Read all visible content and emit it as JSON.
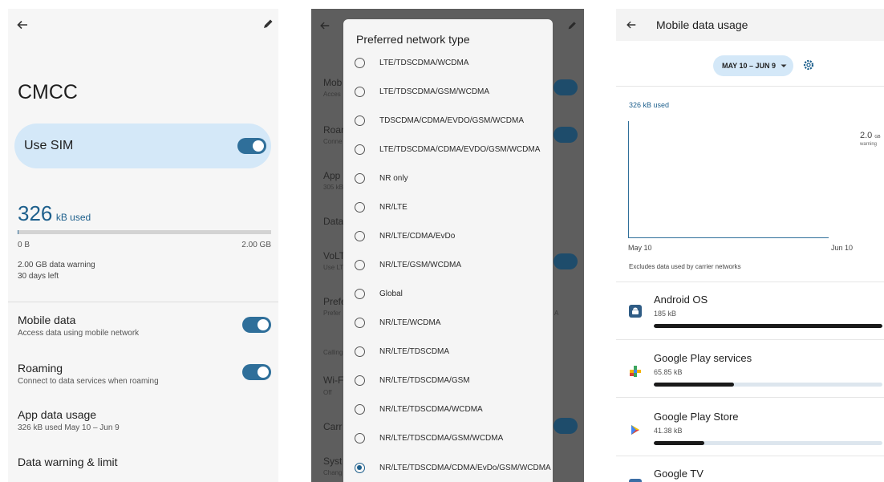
{
  "screen1": {
    "carrier": "CMCC",
    "use_sim": {
      "label": "Use SIM",
      "on": true
    },
    "usage": {
      "amount": "326",
      "unit": "kB used",
      "fraction": 0.0002
    },
    "range": {
      "min": "0 B",
      "max": "2.00 GB"
    },
    "warning_line": "2.00 GB data warning",
    "days_left": "30 days left",
    "rows": [
      {
        "title": "Mobile data",
        "subtitle": "Access data using mobile network",
        "toggle": true
      },
      {
        "title": "Roaming",
        "subtitle": "Connect to data services when roaming",
        "toggle": true
      },
      {
        "title": "App data usage",
        "subtitle": "326 kB used May 10 – Jun 9"
      },
      {
        "title": "Data warning & limit"
      }
    ]
  },
  "screen2": {
    "background_rows": [
      {
        "title": "Mob",
        "subtitle": "Acces"
      },
      {
        "title": "Roar",
        "subtitle": "Conne"
      },
      {
        "title": "App",
        "subtitle": "305 kB"
      },
      {
        "title": "Data"
      },
      {
        "title": "VoLT",
        "subtitle": "Use LT"
      },
      {
        "title": "Prefe",
        "subtitle": "Prefer"
      },
      {
        "title": "Calling"
      },
      {
        "title": "Wi-F",
        "subtitle": "Off"
      },
      {
        "title": "Carr"
      },
      {
        "title": "Syst",
        "subtitle": "Chang"
      }
    ],
    "background_right_fragment": "A",
    "dialog": {
      "title": "Preferred network type",
      "options": [
        "LTE/TDSCDMA/WCDMA",
        "LTE/TDSCDMA/GSM/WCDMA",
        "TDSCDMA/CDMA/EVDO/GSM/WCDMA",
        "LTE/TDSCDMA/CDMA/EVDO/GSM/WCDMA",
        "NR only",
        "NR/LTE",
        "NR/LTE/CDMA/EvDo",
        "NR/LTE/GSM/WCDMA",
        "Global",
        "NR/LTE/WCDMA",
        "NR/LTE/TDSCDMA",
        "NR/LTE/TDSCDMA/GSM",
        "NR/LTE/TDSCDMA/WCDMA",
        "NR/LTE/TDSCDMA/GSM/WCDMA",
        "NR/LTE/TDSCDMA/CDMA/EvDo/GSM/WCDMA"
      ],
      "selected_index": 14
    }
  },
  "screen3": {
    "title": "Mobile data usage",
    "cycle": "MAY 10 – JUN 9",
    "used": "326 kB used",
    "warning": {
      "value": "2.0",
      "unit": "GB",
      "label": "warning"
    },
    "axis": {
      "start": "May 10",
      "end": "Jun 10"
    },
    "note": "Excludes data used by carrier networks",
    "apps": [
      {
        "name": "Android OS",
        "size": "185 kB",
        "fraction": 1.0,
        "icon": "android-icon"
      },
      {
        "name": "Google Play services",
        "size": "65.85 kB",
        "fraction": 0.35,
        "icon": "play-services-icon"
      },
      {
        "name": "Google Play Store",
        "size": "41.38 kB",
        "fraction": 0.22,
        "icon": "play-store-icon"
      },
      {
        "name": "Google TV",
        "icon": "google-tv-icon"
      }
    ]
  },
  "colors": {
    "accent": "#2f6f9a",
    "pill": "#d4e8f8",
    "scrim": "#5e5e5e"
  }
}
